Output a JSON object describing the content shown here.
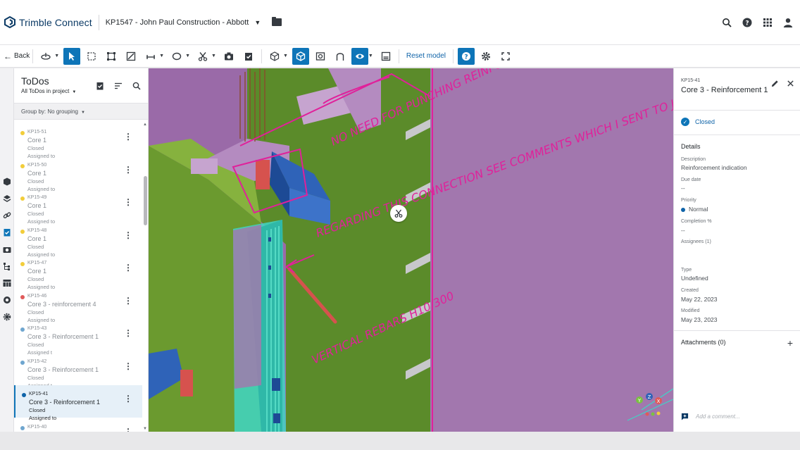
{
  "header": {
    "app_name": "Trimble Connect",
    "project": "KP1547 - John Paul Construction - Abbott",
    "icons": [
      "trimble-logo-icon",
      "folder-icon",
      "search-icon",
      "help-icon",
      "apps-grid-icon",
      "user-icon"
    ]
  },
  "toolbar": {
    "back_label": "Back",
    "reset_label": "Reset model"
  },
  "todos": {
    "title": "ToDos",
    "filter": "All ToDos in project",
    "group_by_label": "Group by:",
    "group_by_value": "No grouping",
    "items": [
      {
        "id": "KP15-51",
        "title": "Core 1",
        "status": "Closed",
        "assigned": "Assigned to",
        "dot": "#f2cd3a"
      },
      {
        "id": "KP15-50",
        "title": "Core 1",
        "status": "Closed",
        "assigned": "Assigned to",
        "dot": "#f2cd3a"
      },
      {
        "id": "KP15-49",
        "title": "Core 1",
        "status": "Closed",
        "assigned": "Assigned to",
        "dot": "#f2cd3a"
      },
      {
        "id": "KP15-48",
        "title": "Core 1",
        "status": "Closed",
        "assigned": "Assigned to",
        "dot": "#f2cd3a"
      },
      {
        "id": "KP15-47",
        "title": "Core 1",
        "status": "Closed",
        "assigned": "Assigned to",
        "dot": "#f2cd3a"
      },
      {
        "id": "KP15-46",
        "title": "Core 3 - reinforcement 4",
        "status": "Closed",
        "assigned": "Assigned to",
        "dot": "#e05a5a"
      },
      {
        "id": "KP15-43",
        "title": "Core 3 - Reinforcement 1",
        "status": "Closed",
        "assigned": "Assigned t",
        "dot": "#6fa6cf"
      },
      {
        "id": "KP15-42",
        "title": "Core 3 - Reinforcement 1",
        "status": "Closed",
        "assigned": "Assigned t",
        "dot": "#6fa6cf"
      },
      {
        "id": "KP15-41",
        "title": "Core 3 - Reinforcement 1",
        "status": "Closed",
        "assigned": "Assigned to",
        "dot": "#0e63a8"
      },
      {
        "id": "KP15-40",
        "title": "",
        "status": "",
        "assigned": "",
        "dot": "#6fa6cf"
      }
    ]
  },
  "details": {
    "id": "KP15-41",
    "title": "Core 3 - Reinforcement 1",
    "status": "Closed",
    "section_details": "Details",
    "description_label": "Description",
    "description_value": "Reinforcement indication",
    "due_label": "Due date",
    "due_value": "--",
    "priority_label": "Priority",
    "priority_value": "Normal",
    "completion_label": "Completion %",
    "completion_value": "--",
    "assignees_label": "Assignees (1)",
    "type_label": "Type",
    "type_value": "Undefined",
    "created_label": "Created",
    "created_value": "May 22, 2023",
    "modified_label": "Modified",
    "modified_value": "May 23, 2023",
    "attachments_label": "Attachments (0)",
    "comment_placeholder": "Add a comment..."
  },
  "markup": {
    "note1": "NO NEED FOR PUNCHING REINFORCEMENT",
    "note2": "REGARDING THIS CONNECTION SEE COMMENTS WHICH I SENT TO JIM AND GIVE ME A CALL.",
    "note3": "VERTICAL REBARS H10/300",
    "axes": [
      "Y",
      "Z",
      "X"
    ]
  },
  "colors": {
    "accent": "#0e75b8",
    "slab": "#9a6aa8",
    "wall": "#5a8a2c",
    "markup": "#e0219a",
    "steel": "#2f63b8",
    "rebar": "#3fe0c0"
  }
}
